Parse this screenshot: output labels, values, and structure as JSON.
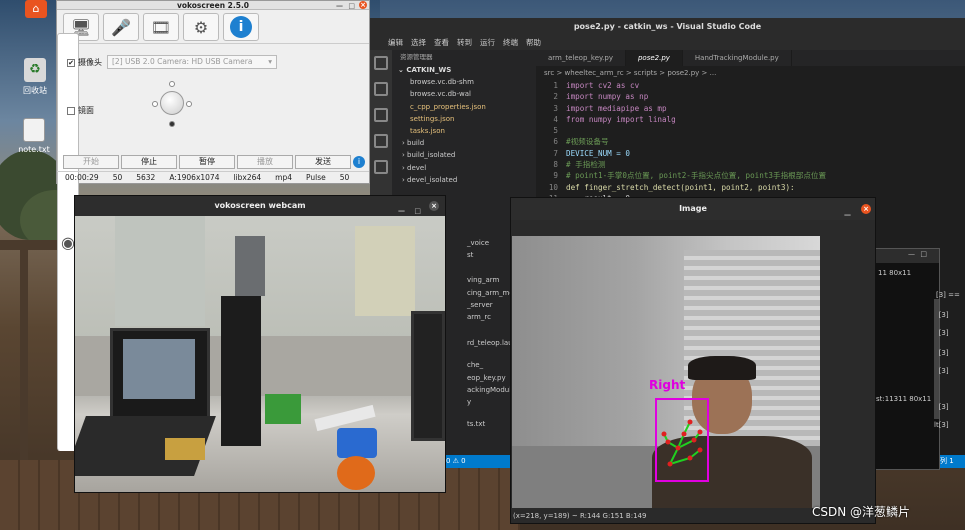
{
  "desktop": {
    "icons": [
      {
        "label": ""
      },
      {
        "label": "回收站"
      },
      {
        "label": "note.txt"
      }
    ]
  },
  "vokoscreen": {
    "title": "vokoscreen 2.5.0",
    "camera_label": "摄像头",
    "camera_select": "[2] USB 2.0 Camera: HD USB Camera",
    "mirror_label": "镜面",
    "buttons": [
      "开始",
      "停止",
      "暂停",
      "播放",
      "发送"
    ],
    "status": [
      "00:00:29",
      "50",
      "5632",
      "A:1906x1074",
      "libx264",
      "mp4",
      "Pulse",
      "50"
    ]
  },
  "vscode": {
    "title": "pose2.py - catkin_ws - Visual Studio Code",
    "menu": [
      "编辑",
      "选择",
      "查看",
      "转到",
      "运行",
      "终端",
      "帮助"
    ],
    "explorer_header": "资源管理器",
    "workspace": "CATKIN_WS",
    "sidebar_items": [
      "browse.vc.db-shm",
      "browse.vc.db-wal",
      "c_cpp_properties.json",
      "settings.json",
      "tasks.json",
      "build",
      "build_isolated",
      "devel",
      "devel_isolated"
    ],
    "sidebar_items_lower": [
      "_voice",
      "st",
      "ving_arm",
      "cing_arm_moveit_c",
      "_server",
      "arm_rc",
      "rd_teleop.launch",
      "che_",
      "eop_key.py",
      "ackingModule.py",
      "y",
      "ts.txt"
    ],
    "tabs": [
      "arm_teleop_key.py",
      "pose2.py",
      "HandTrackingModule.py"
    ],
    "breadcrumb": "src > wheeltec_arm_rc > scripts > pose2.py > ...",
    "code_lines": [
      {
        "n": "1",
        "text": "import cv2 as cv"
      },
      {
        "n": "2",
        "text": "import numpy as np"
      },
      {
        "n": "3",
        "text": "import mediapipe as mp"
      },
      {
        "n": "4",
        "text": "from numpy import linalg"
      },
      {
        "n": "5",
        "text": ""
      },
      {
        "n": "6",
        "text": "#视频设备号"
      },
      {
        "n": "7",
        "text": "DEVICE_NUM = 0"
      },
      {
        "n": "8",
        "text": "# 手指检测"
      },
      {
        "n": "9",
        "text": "# point1-手掌0点位置, point2-手指尖点位置, point3手指根部点位置"
      },
      {
        "n": "10",
        "text": "def finger_stretch_detect(point1, point2, point3):"
      },
      {
        "n": "11",
        "text": "    result = 0"
      }
    ],
    "status_left": "0 ⚠ 0",
    "status_right": "列 1"
  },
  "webcam": {
    "title": "vokoscreen webcam"
  },
  "image_window": {
    "title": "Image",
    "hand_label": "Right",
    "status": "(x=218, y=189) ~ R:144 G:151 B:149"
  },
  "terminal": {
    "lines": [
      "11 80x11",
      "[3] ==",
      "lt[3]",
      "lt[3]",
      "lt[3]",
      "lt[3]",
      "st:11311 80x11",
      "lt[3]",
      "lt[3]"
    ]
  },
  "watermark": "CSDN @洋葱鳞片"
}
